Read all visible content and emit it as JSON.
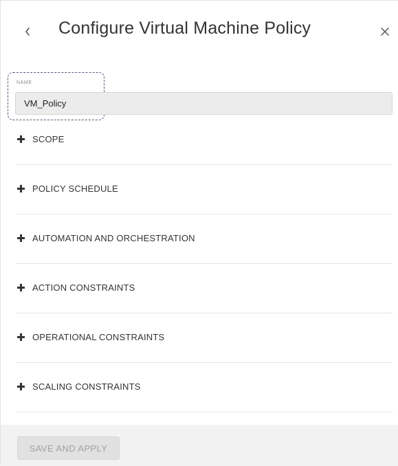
{
  "header": {
    "title": "Configure Virtual Machine Policy",
    "back_icon": "chevron-left-icon",
    "close_icon": "close-icon"
  },
  "name_field": {
    "label": "NAME",
    "value": "VM_Policy"
  },
  "sections": [
    {
      "label": "SCOPE"
    },
    {
      "label": "POLICY SCHEDULE"
    },
    {
      "label": "AUTOMATION AND ORCHESTRATION"
    },
    {
      "label": "ACTION CONSTRAINTS"
    },
    {
      "label": "OPERATIONAL CONSTRAINTS"
    },
    {
      "label": "SCALING CONSTRAINTS"
    }
  ],
  "footer": {
    "save_label": "SAVE AND APPLY",
    "save_enabled": false
  }
}
